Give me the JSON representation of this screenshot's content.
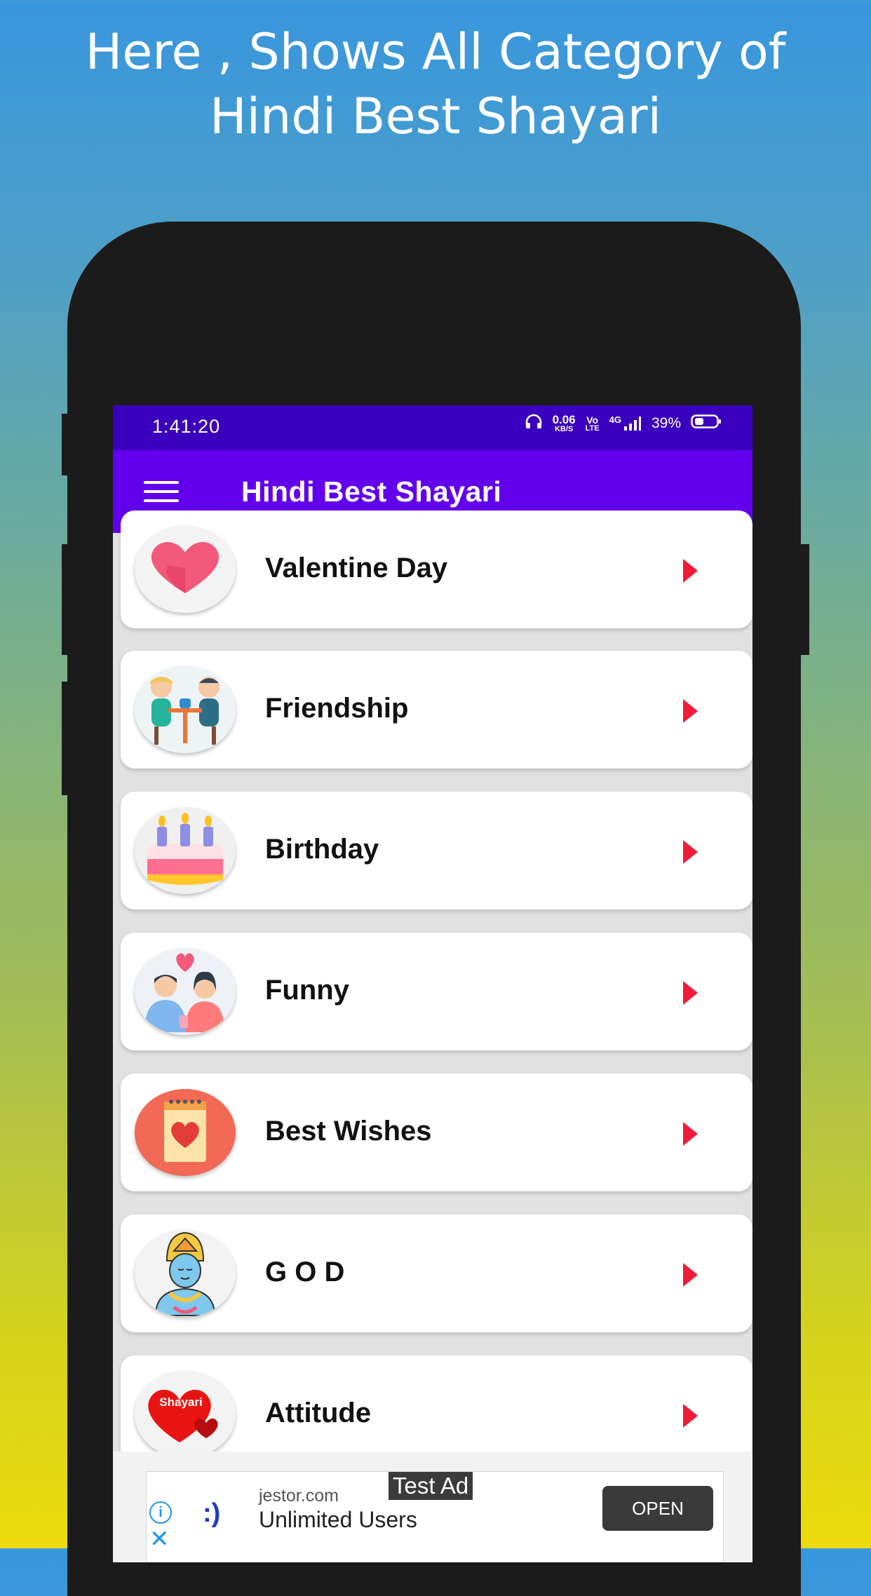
{
  "headline": {
    "line1": "Here , Shows All Category of",
    "line2": "Hindi Best Shayari"
  },
  "status_bar": {
    "time": "1:41:20",
    "speed_value": "0.06",
    "speed_unit": "KB/S",
    "volte_top": "Vo",
    "volte_bottom": "LTE",
    "network": "4G",
    "battery": "39%"
  },
  "app_bar": {
    "title": "Hindi Best Shayari",
    "menu_icon": "hamburger-menu-icon"
  },
  "categories": [
    {
      "label": "Valentine Day",
      "icon": "valentine-heart-icon"
    },
    {
      "label": "Friendship",
      "icon": "friendship-icon"
    },
    {
      "label": "Birthday",
      "icon": "birthday-cake-icon"
    },
    {
      "label": "Funny",
      "icon": "funny-couple-icon"
    },
    {
      "label": "Best Wishes",
      "icon": "best-wishes-icon"
    },
    {
      "label": "G O D",
      "icon": "god-icon"
    },
    {
      "label": "Attitude",
      "icon": "attitude-shayari-icon"
    }
  ],
  "attitude_icon_text": "Shayari",
  "ad": {
    "tag": "Test Ad",
    "domain": "jestor.com",
    "headline": "Unlimited Users",
    "cta": "OPEN",
    "info_symbol": "i",
    "close_symbol": "✕",
    "logo_text": ":)"
  },
  "colors": {
    "status_bar": "#3b00bd",
    "app_bar": "#6200ee",
    "arrow": "#ef1b39",
    "phone_body": "#1b1b1b"
  }
}
